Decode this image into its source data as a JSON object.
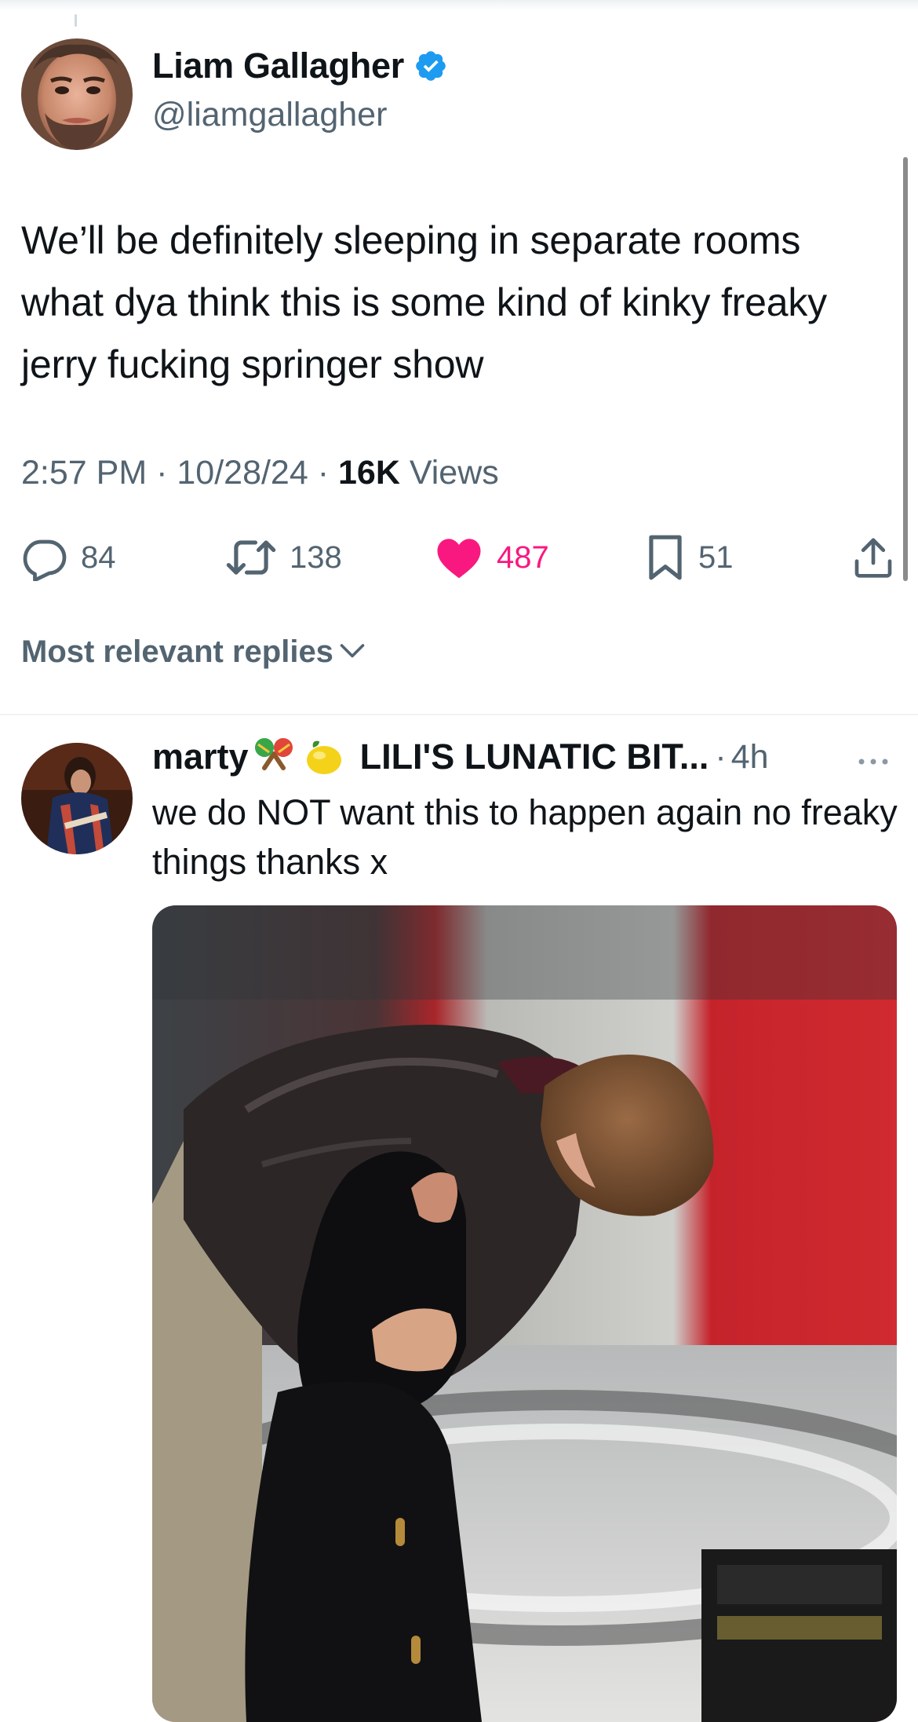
{
  "tweet": {
    "author_name": "Liam Gallagher",
    "author_handle": "@liamgallagher",
    "avatar_icon": "avatar-photo",
    "verified_icon": "verified-badge-icon",
    "text": "We’ll be definitely sleeping in separate rooms what dya think this is some kind of kinky freaky jerry fucking springer show",
    "time": "2:57 PM",
    "date": "10/28/24",
    "views_count": "16K",
    "views_label": "Views",
    "separator": "·"
  },
  "actions": {
    "reply": {
      "icon": "reply-bubble-icon",
      "count": "84"
    },
    "retweet": {
      "icon": "retweet-icon",
      "count": "138"
    },
    "like": {
      "icon": "heart-filled-icon",
      "count": "487"
    },
    "bookmark": {
      "icon": "bookmark-icon",
      "count": "51"
    },
    "share": {
      "icon": "share-icon"
    }
  },
  "replies": {
    "sort_label": "Most relevant replies",
    "sort_icon": "chevron-down-icon",
    "items": [
      {
        "display_name": "marty",
        "name_emojis": [
          "maracas",
          "lemon"
        ],
        "display_name_suffix": "LILI'S LUNATIC BIT...",
        "separator": "·",
        "time": "4h",
        "more_icon": "more-dots-icon",
        "text": "we do NOT want this to happen again no freaky things thanks x",
        "media": "photo"
      }
    ]
  },
  "colors": {
    "text_primary": "#0f1419",
    "text_secondary": "#536471",
    "verified_blue": "#1d9bf0",
    "like_pink": "#f91880",
    "divider": "#eff3f4"
  }
}
